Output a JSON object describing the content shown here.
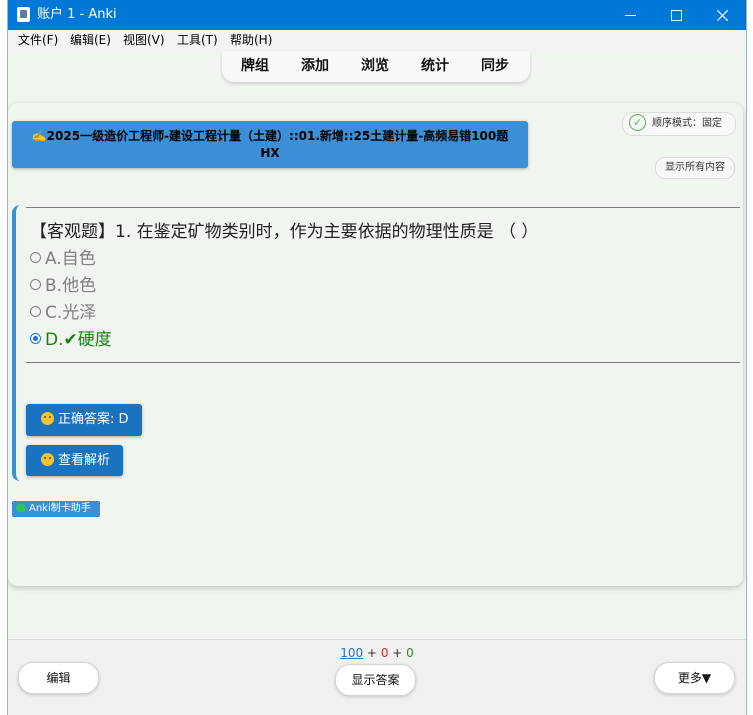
{
  "window": {
    "title": "账户 1 - Anki"
  },
  "menu": [
    "文件(F)",
    "编辑(E)",
    "视图(V)",
    "工具(T)",
    "帮助(H)"
  ],
  "nav": [
    "牌组",
    "添加",
    "浏览",
    "统计",
    "同步"
  ],
  "deck": {
    "line1": "✍️2025一级造价工程师-建设工程计量（土建）::01.新增::25土建计量-高频易错100题",
    "line2": "HX"
  },
  "mode": {
    "check": "✓",
    "label": "顺序模式：固定"
  },
  "show_all_label": "显示所有内容",
  "question": {
    "text": "【客观题】1. 在鉴定矿物类别时，作为主要依据的物理性质是 （ ）"
  },
  "options": [
    {
      "label": "A.自色",
      "selected": false
    },
    {
      "label": "B.他色",
      "selected": false
    },
    {
      "label": "C.光泽",
      "selected": false
    },
    {
      "label": "D.✔硬度",
      "selected": true
    }
  ],
  "answer_button": "正确答案: D",
  "analysis_button": "查看解析",
  "helper_badge": "Anki制卡助手",
  "counts": {
    "new": "100",
    "sep1": "+",
    "learn": "0",
    "sep2": "+",
    "review": "0"
  },
  "bottom": {
    "edit": "编辑",
    "show_answer": "显示答案",
    "more": "更多▼"
  },
  "colors": {
    "titlebar": "#0078d7",
    "accent": "#3a8fd7",
    "answer_button": "#1a73c0",
    "correct": "#1a7f1a",
    "new": "#2672d8",
    "learn": "#c03030",
    "review": "#2a8a2a"
  }
}
